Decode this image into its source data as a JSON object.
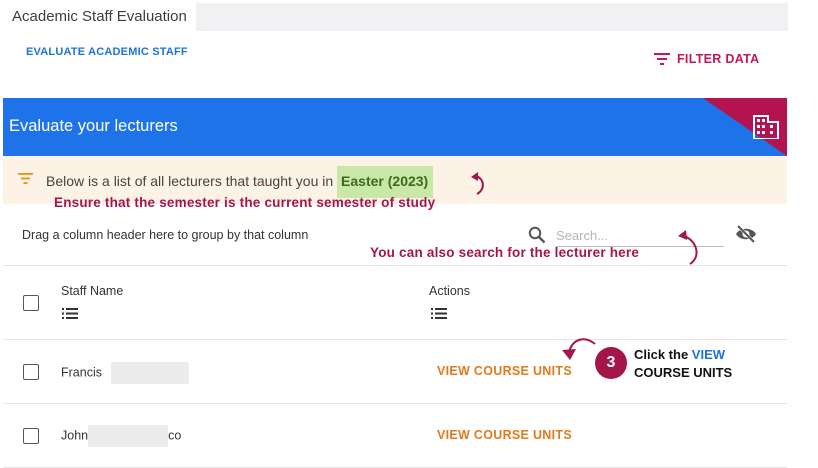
{
  "window": {
    "title": "Academic Staff Evaluation"
  },
  "header": {
    "breadcrumb_link": "EVALUATE ACADEMIC STAFF",
    "filter_label": "FILTER DATA"
  },
  "banner": {
    "title": "Evaluate your lecturers",
    "icon": "building-icon",
    "accent_color": "#b3134f",
    "background_color": "#1e73e8"
  },
  "notice": {
    "text": "Below is a list of all lecturers that taught you in",
    "semester": "Easter (2023)",
    "icon": "filter-icon"
  },
  "annotations": {
    "semester_note": "Ensure that the semester is the current semester of study",
    "search_note": "You can also search for the lecturer here",
    "step_number": "3",
    "step_text_prefix": "Click the ",
    "step_text_highlight": "VIEW",
    "step_text_suffix": "COURSE UNITS"
  },
  "grid": {
    "grouping_hint": "Drag a column header here to group by that column",
    "search_placeholder": "Search...",
    "columns": [
      {
        "label": "Staff Name"
      },
      {
        "label": "Actions"
      }
    ],
    "rows": [
      {
        "first_name": "Francis",
        "name_suffix": "",
        "action": "VIEW COURSE UNITS"
      },
      {
        "first_name": "John",
        "name_suffix": "co",
        "action": "VIEW COURSE UNITS"
      }
    ]
  }
}
